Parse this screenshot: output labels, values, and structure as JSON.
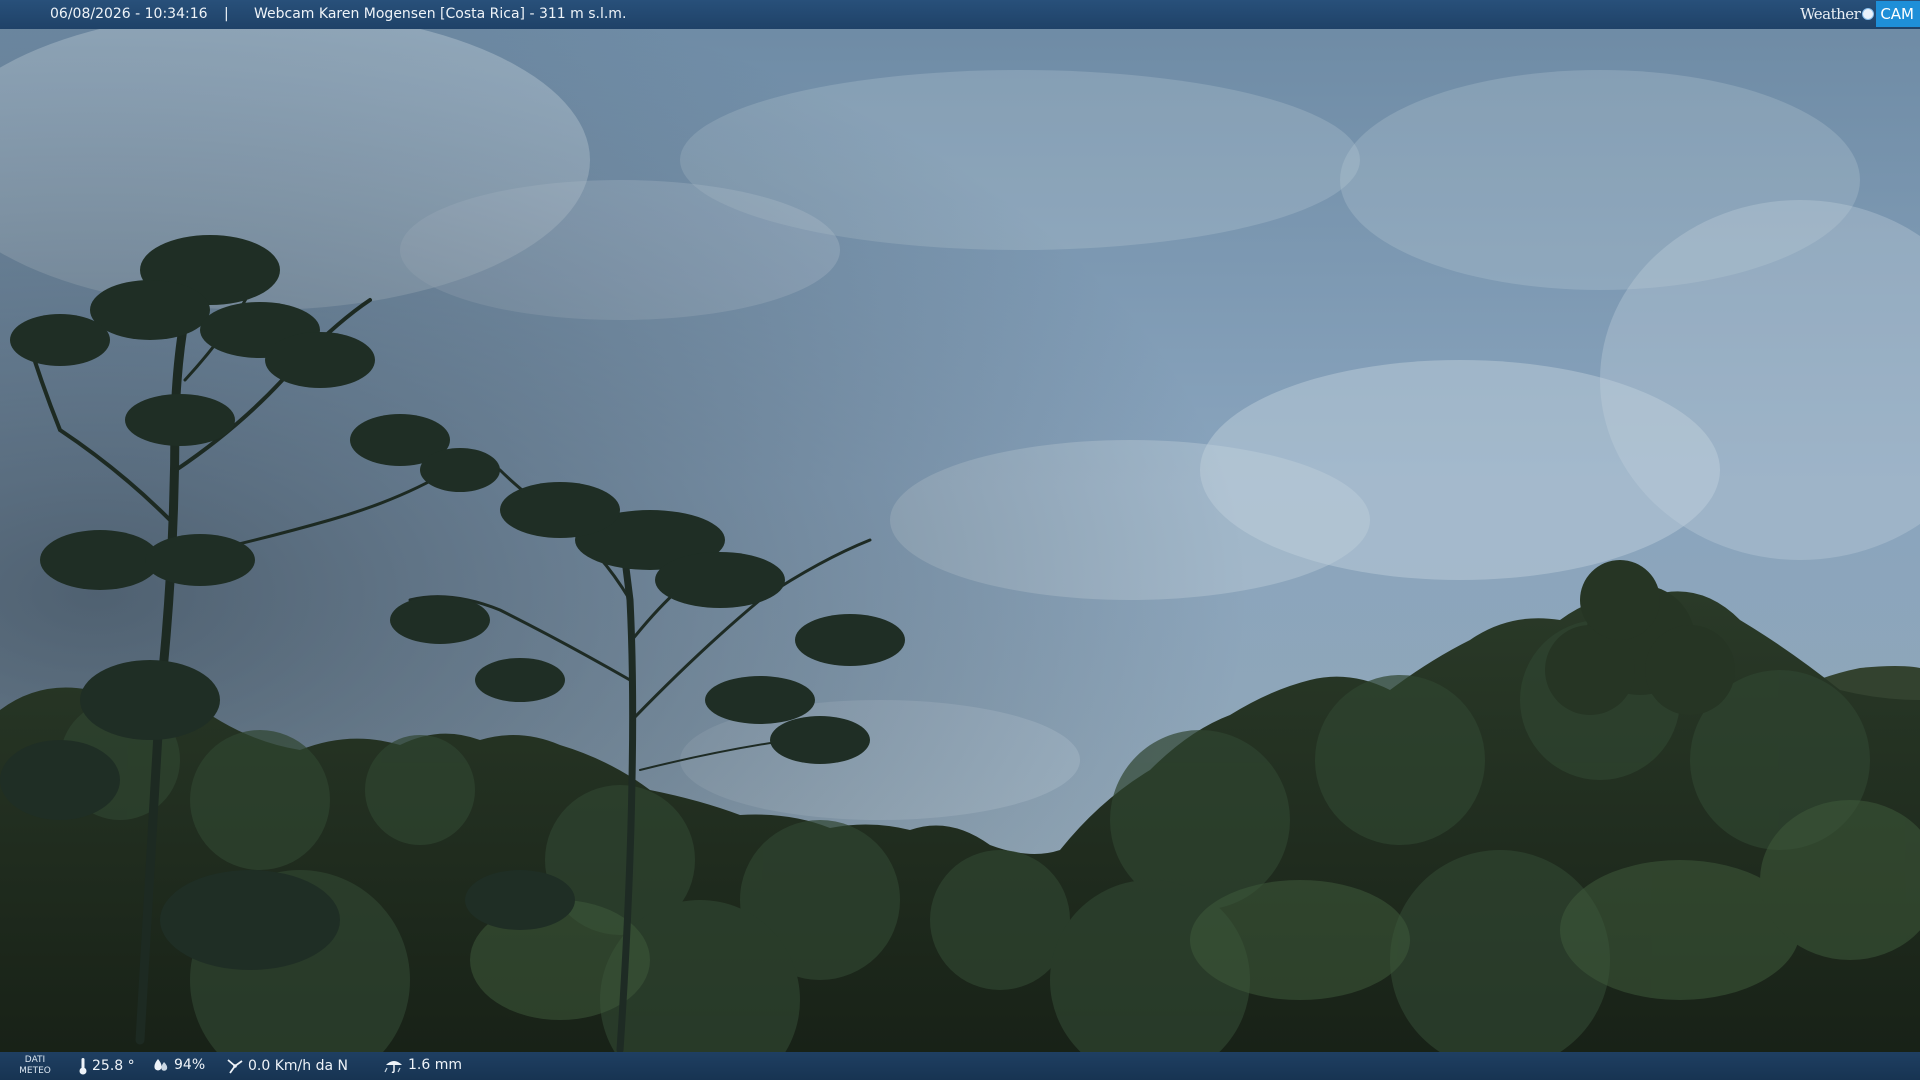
{
  "header": {
    "timestamp": "06/08/2026 - 10:34:16",
    "separator": "|",
    "title": "Webcam Karen Mogensen [Costa Rica]  - 311 m s.l.m."
  },
  "logo": {
    "word": "Weather",
    "badge": "CAM"
  },
  "weather": {
    "label_line1": "DATI",
    "label_line2": "METEO",
    "temperature": "25.8 °",
    "humidity": "94%",
    "wind": "0.0 Km/h da N",
    "rain": "1.6 mm"
  },
  "icons": {
    "temperature": "thermometer-icon",
    "humidity": "humidity-drop-icon",
    "wind": "wind-icon",
    "rain": "rain-umbrella-icon"
  },
  "colors": {
    "bar": "#1f4268",
    "logo_accent": "#1e8fd8",
    "sky": "#8ea8c0",
    "foliage": "#1e2a1c"
  }
}
